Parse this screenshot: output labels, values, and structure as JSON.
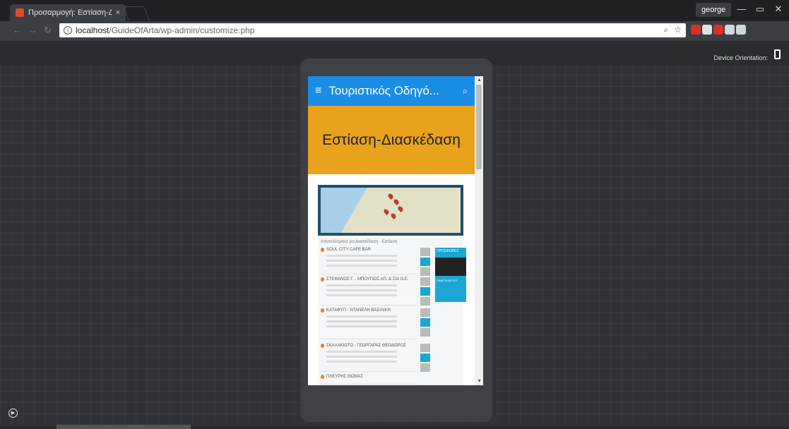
{
  "browser": {
    "tab_title": "Προσαρμογή: Εστίαση-Δ",
    "tab_close": "×",
    "user": "george",
    "window_controls": {
      "minimize": "—",
      "maximize": "▭",
      "close": "✕"
    },
    "url_host": "localhost",
    "url_path": "/GuideOfArta/wp-admin/customize.php",
    "omni_icons": [
      "⌕",
      "☆"
    ],
    "extension_colors": [
      "#d93025",
      "#e0e0e0",
      "#d93025",
      "#cfd8dc",
      "#cfd8dc"
    ]
  },
  "customizer": {
    "device_orientation_label": "Device Orientation:"
  },
  "mobile": {
    "header_title": "Τουριστικός Οδηγό...",
    "menu_icon": "≡",
    "search_icon": "⌕",
    "banner_title": "Εστίαση-Διασκέδαση",
    "list_heading": "Αποτελέσματα για Διασκέδαση - Εστίαση",
    "entries": [
      {
        "title": "SOUL CITY CAFE BAR"
      },
      {
        "title": "ΣΤΕΦΑΝΟΣ Γ. - ΜΠΟΥΓΙΟΣ ΑΠ. & ΣΙΑ Ο.Ε."
      },
      {
        "title": "ΚΑΤΑΦΥΓΙ - ΝΤΑΝΕΛΗ ΒΑΣΙΛΙΚΗ"
      },
      {
        "title": "ΣΚΑΛΑΚΙΩΤΟ - ΓΕΩΡΓΑΡΑΣ ΘΕΟΔΩΡΟΣ"
      },
      {
        "title": "ΠΛΕΥΡΗΣ ΘΩΜΑΣ"
      }
    ],
    "offer_label": "ΠΡΟΣΦΟΡΕΣ",
    "offer_badge": "ΠΑΚΕΤΑ ΕΚΤΟΣ"
  }
}
